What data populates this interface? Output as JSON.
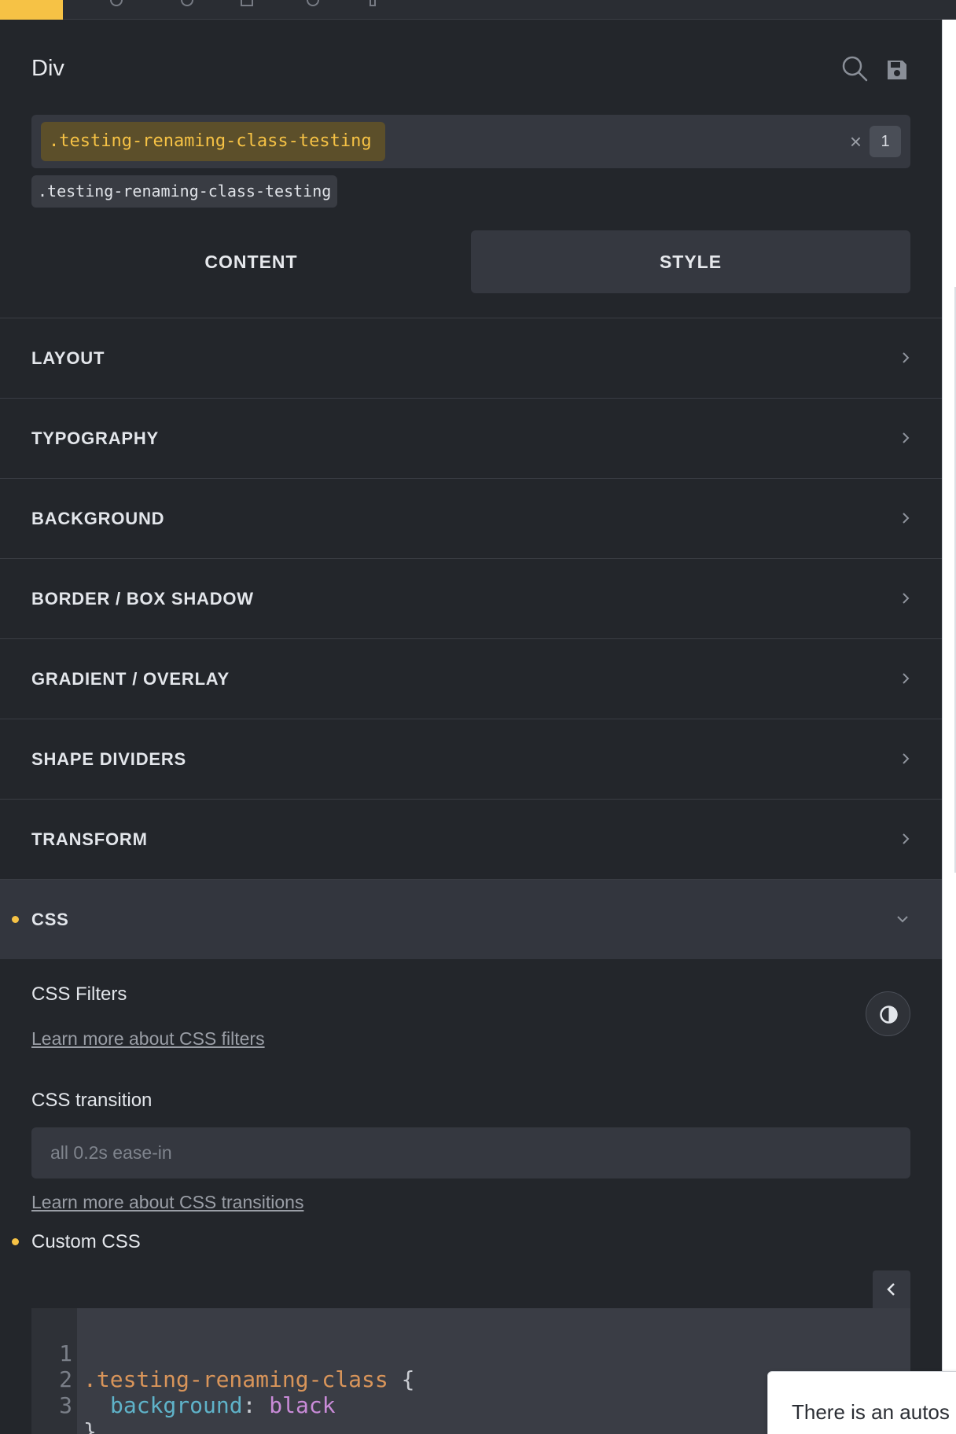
{
  "panel": {
    "title": "Div"
  },
  "selector": {
    "active_class": ".testing-renaming-class-testing",
    "count": "1",
    "clear_symbol": "×",
    "suggestion": ".testing-renaming-class-testing"
  },
  "tabs": [
    {
      "label": "CONTENT",
      "active": false
    },
    {
      "label": "STYLE",
      "active": true
    }
  ],
  "sections": [
    {
      "label": "LAYOUT"
    },
    {
      "label": "TYPOGRAPHY"
    },
    {
      "label": "BACKGROUND"
    },
    {
      "label": "BORDER / BOX SHADOW"
    },
    {
      "label": "GRADIENT / OVERLAY"
    },
    {
      "label": "SHAPE DIVIDERS"
    },
    {
      "label": "TRANSFORM"
    },
    {
      "label": "CSS",
      "open": true,
      "modified": true
    }
  ],
  "css": {
    "filters_label": "CSS Filters",
    "filters_link": "Learn more about CSS filters",
    "transition_label": "CSS transition",
    "transition_placeholder": "all 0.2s ease-in",
    "transition_link": "Learn more about CSS transitions",
    "custom_label": "Custom CSS",
    "code_lines": [
      {
        "num": "1",
        "selector": ".testing-renaming-class",
        "brace": " {"
      },
      {
        "num": "2",
        "prop": "background",
        "colon": ": ",
        "value": "black"
      },
      {
        "num": "3",
        "close": "}"
      }
    ]
  },
  "toast": {
    "text": "There is an autos"
  },
  "colors": {
    "accent": "#f6c245",
    "panel_bg": "#23262b",
    "input_bg": "#353840"
  },
  "icons": [
    "search-icon",
    "save-icon",
    "clear-icon",
    "chevron-right-icon",
    "chevron-down-icon",
    "contrast-icon",
    "chevron-left-icon"
  ]
}
